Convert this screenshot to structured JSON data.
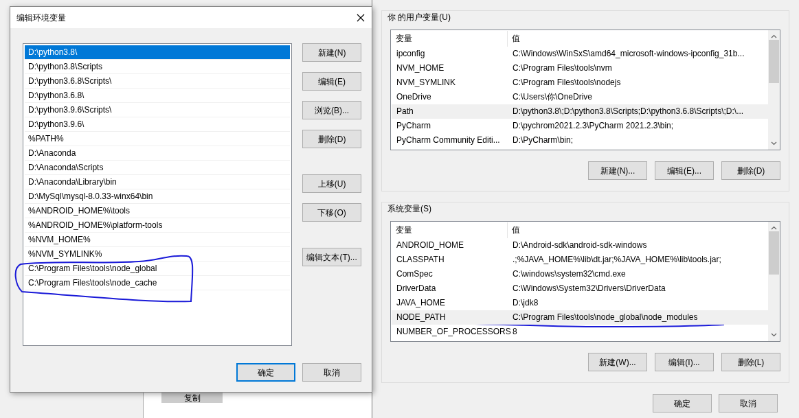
{
  "background_window": {
    "copy_button": "复制"
  },
  "edit_dialog": {
    "title": "编辑环境变量",
    "entries": [
      {
        "text": "D:\\python3.8\\",
        "selected": true,
        "marked": false
      },
      {
        "text": "D:\\python3.8\\Scripts",
        "selected": false,
        "marked": false
      },
      {
        "text": "D:\\python3.6.8\\Scripts\\",
        "selected": false,
        "marked": false
      },
      {
        "text": "D:\\python3.6.8\\",
        "selected": false,
        "marked": false
      },
      {
        "text": "D:\\python3.9.6\\Scripts\\",
        "selected": false,
        "marked": false
      },
      {
        "text": "D:\\python3.9.6\\",
        "selected": false,
        "marked": false
      },
      {
        "text": "%PATH%",
        "selected": false,
        "marked": false
      },
      {
        "text": "D:\\Anaconda",
        "selected": false,
        "marked": false
      },
      {
        "text": "D:\\Anaconda\\Scripts",
        "selected": false,
        "marked": false
      },
      {
        "text": "D:\\Anaconda\\Library\\bin",
        "selected": false,
        "marked": false
      },
      {
        "text": "D:\\MySql\\mysql-8.0.33-winx64\\bin",
        "selected": false,
        "marked": false
      },
      {
        "text": "%ANDROID_HOME%\\tools",
        "selected": false,
        "marked": false
      },
      {
        "text": "%ANDROID_HOME%\\platform-tools",
        "selected": false,
        "marked": false
      },
      {
        "text": "%NVM_HOME%",
        "selected": false,
        "marked": false
      },
      {
        "text": "%NVM_SYMLINK%",
        "selected": false,
        "marked": false
      },
      {
        "text": "C:\\Program Files\\tools\\node_global",
        "selected": false,
        "marked": true
      },
      {
        "text": "C:\\Program Files\\tools\\node_cache",
        "selected": false,
        "marked": true
      }
    ],
    "side_button_groups": [
      [
        "新建(N)",
        "编辑(E)",
        "浏览(B)...",
        "删除(D)"
      ],
      [
        "上移(U)",
        "下移(O)"
      ],
      [
        "编辑文本(T)..."
      ]
    ],
    "buttons": [
      {
        "label": "确定",
        "default": true
      },
      {
        "label": "取消",
        "default": false
      }
    ]
  },
  "env_window": {
    "groups": [
      {
        "label": "你 的用户变量(U)",
        "columns": [
          "变量",
          "值"
        ],
        "rows": [
          {
            "name": "ipconfig",
            "value": "C:\\Windows\\WinSxS\\amd64_microsoft-windows-ipconfig_31b...",
            "selected": false,
            "marked": false
          },
          {
            "name": "NVM_HOME",
            "value": "C:\\Program Files\\tools\\nvm",
            "selected": false,
            "marked": false
          },
          {
            "name": "NVM_SYMLINK",
            "value": "C:\\Program Files\\tools\\nodejs",
            "selected": false,
            "marked": false
          },
          {
            "name": "OneDrive",
            "value": "C:\\Users\\你\\OneDrive",
            "selected": false,
            "marked": false
          },
          {
            "name": "Path",
            "value": "D:\\python3.8\\;D:\\python3.8\\Scripts;D:\\python3.6.8\\Scripts\\;D:\\...",
            "selected": true,
            "marked": false
          },
          {
            "name": "PyCharm",
            "value": "D:\\pychrom2021.2.3\\PyCharm 2021.2.3\\bin;",
            "selected": false,
            "marked": false
          },
          {
            "name": "PyCharm Community Editi...",
            "value": "D:\\PyCharm\\bin;",
            "selected": false,
            "marked": false
          }
        ],
        "buttons": [
          "新建(N)...",
          "编辑(E)...",
          "删除(D)"
        ]
      },
      {
        "label": "系统变量(S)",
        "columns": [
          "变量",
          "值"
        ],
        "rows": [
          {
            "name": "ANDROID_HOME",
            "value": "D:\\Android-sdk\\android-sdk-windows",
            "selected": false,
            "marked": false
          },
          {
            "name": "CLASSPATH",
            "value": ".;%JAVA_HOME%\\lib\\dt.jar;%JAVA_HOME%\\lib\\tools.jar;",
            "selected": false,
            "marked": false
          },
          {
            "name": "ComSpec",
            "value": "C:\\windows\\system32\\cmd.exe",
            "selected": false,
            "marked": false
          },
          {
            "name": "DriverData",
            "value": "C:\\Windows\\System32\\Drivers\\DriverData",
            "selected": false,
            "marked": false
          },
          {
            "name": "JAVA_HOME",
            "value": "D:\\jdk8",
            "selected": false,
            "marked": false
          },
          {
            "name": "NODE_PATH",
            "value": "C:\\Program Files\\tools\\node_global\\node_modules",
            "selected": true,
            "marked": true
          },
          {
            "name": "NUMBER_OF_PROCESSORS",
            "value": "8",
            "selected": false,
            "marked": false
          }
        ],
        "buttons": [
          "新建(W)...",
          "编辑(I)...",
          "删除(L)"
        ]
      }
    ],
    "buttons": [
      {
        "label": "确定",
        "default": false
      },
      {
        "label": "取消",
        "default": false
      }
    ]
  }
}
